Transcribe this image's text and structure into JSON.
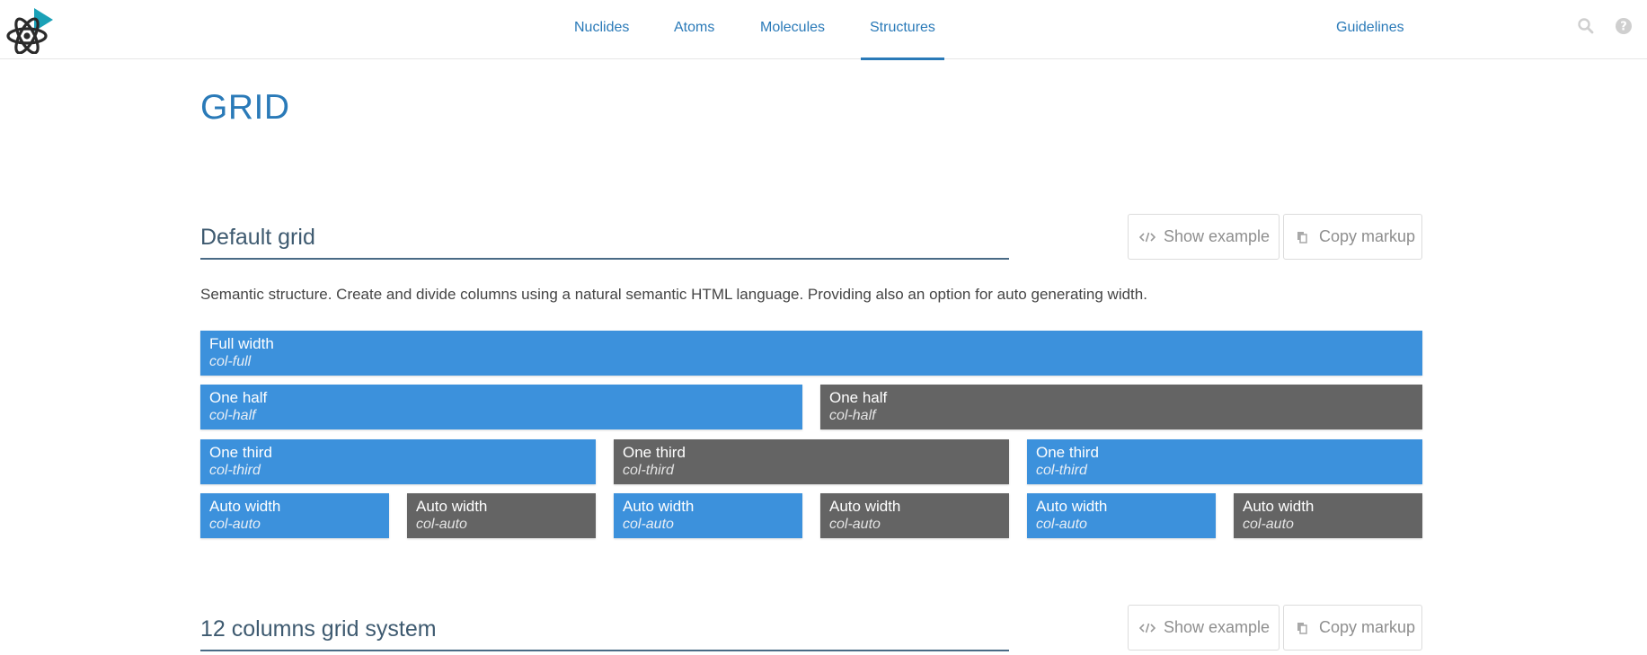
{
  "header": {
    "nav": [
      "Nuclides",
      "Atoms",
      "Molecules",
      "Structures"
    ],
    "active_nav": "Structures",
    "guidelines": "Guidelines",
    "icons": [
      "atom-logo-icon",
      "search-icon",
      "help-icon"
    ]
  },
  "page": {
    "title": "GRID"
  },
  "sections": [
    {
      "title": "Default grid",
      "show_example": "Show example",
      "copy_markup": "Copy markup",
      "description": "Semantic structure. Create and divide columns using a natural semantic HTML language. Providing also an option for auto generating width.",
      "rows": [
        [
          {
            "label": "Full width",
            "class": "col-full",
            "color": "blue"
          }
        ],
        [
          {
            "label": "One half",
            "class": "col-half",
            "color": "blue"
          },
          {
            "label": "One half",
            "class": "col-half",
            "color": "gray"
          }
        ],
        [
          {
            "label": "One third",
            "class": "col-third",
            "color": "blue"
          },
          {
            "label": "One third",
            "class": "col-third",
            "color": "gray"
          },
          {
            "label": "One third",
            "class": "col-third",
            "color": "blue"
          }
        ],
        [
          {
            "label": "Auto width",
            "class": "col-auto",
            "color": "blue"
          },
          {
            "label": "Auto width",
            "class": "col-auto",
            "color": "gray"
          },
          {
            "label": "Auto width",
            "class": "col-auto",
            "color": "blue"
          },
          {
            "label": "Auto width",
            "class": "col-auto",
            "color": "gray"
          },
          {
            "label": "Auto width",
            "class": "col-auto",
            "color": "blue"
          },
          {
            "label": "Auto width",
            "class": "col-auto",
            "color": "gray"
          }
        ]
      ]
    },
    {
      "title": "12 columns grid system",
      "show_example": "Show example",
      "copy_markup": "Copy markup"
    }
  ],
  "colors": {
    "accent": "#2a7ab8",
    "blue_cell": "#3c91dc",
    "gray_cell": "#646464",
    "logo_teal": "#1aa1b7"
  }
}
